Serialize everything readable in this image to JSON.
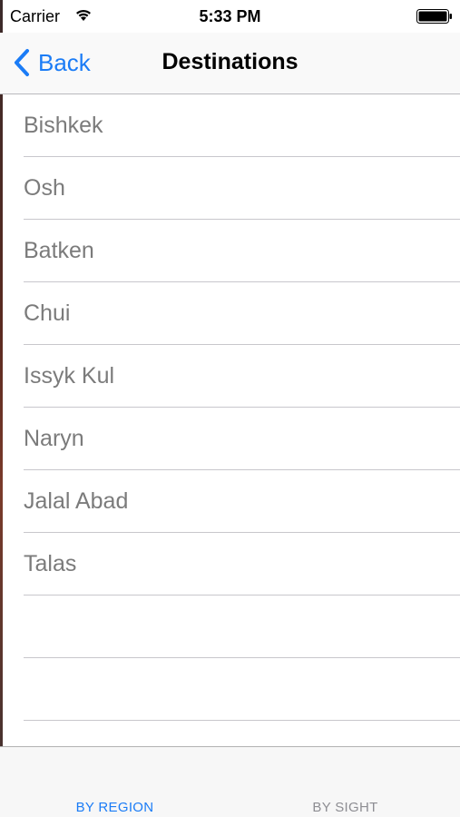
{
  "status_bar": {
    "carrier": "Carrier",
    "time": "5:33 PM"
  },
  "nav": {
    "back_label": "Back",
    "title": "Destinations"
  },
  "destinations": [
    "Bishkek",
    "Osh",
    "Batken",
    "Chui",
    "Issyk Kul",
    "Naryn",
    "Jalal Abad",
    "Talas"
  ],
  "tabs": [
    {
      "label": "BY REGION",
      "selected": true,
      "color": "#1b7cf6"
    },
    {
      "label": "BY SIGHT",
      "selected": false,
      "color": "#8e8e93"
    }
  ],
  "colors": {
    "accent": "#1b7cf6",
    "row_text": "#7b7b7b",
    "separator": "#c8c7cc"
  },
  "icons": {
    "wifi": "wifi-icon",
    "battery": "battery-icon",
    "back": "chevron-left-icon"
  }
}
